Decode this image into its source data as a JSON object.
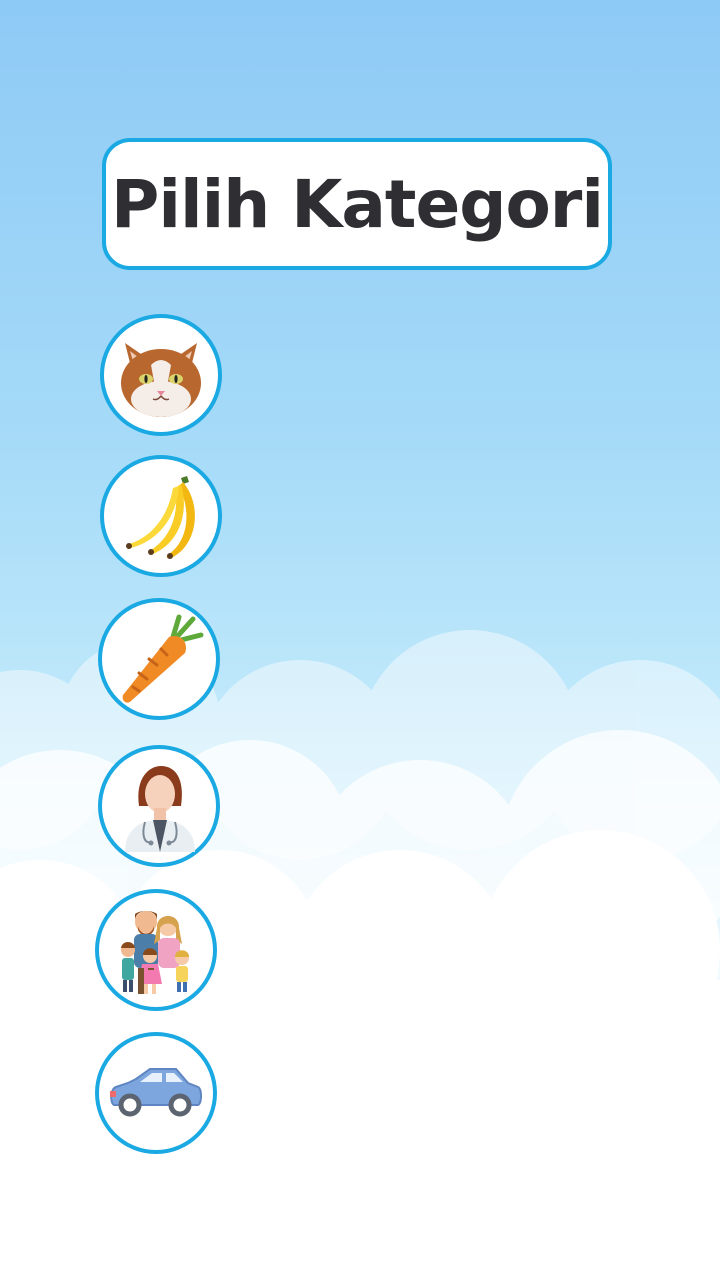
{
  "screen": {
    "title": "Pilih Kategori"
  },
  "categories": [
    {
      "icon": "cat-icon"
    },
    {
      "icon": "banana-icon"
    },
    {
      "icon": "carrot-icon"
    },
    {
      "icon": "doctor-icon"
    },
    {
      "icon": "family-icon"
    },
    {
      "icon": "car-icon"
    }
  ],
  "colors": {
    "accent": "#1aa9e2",
    "title_text": "#2f2f33",
    "sky_top": "#8ecaf6",
    "sky_bottom": "#ffffff"
  }
}
